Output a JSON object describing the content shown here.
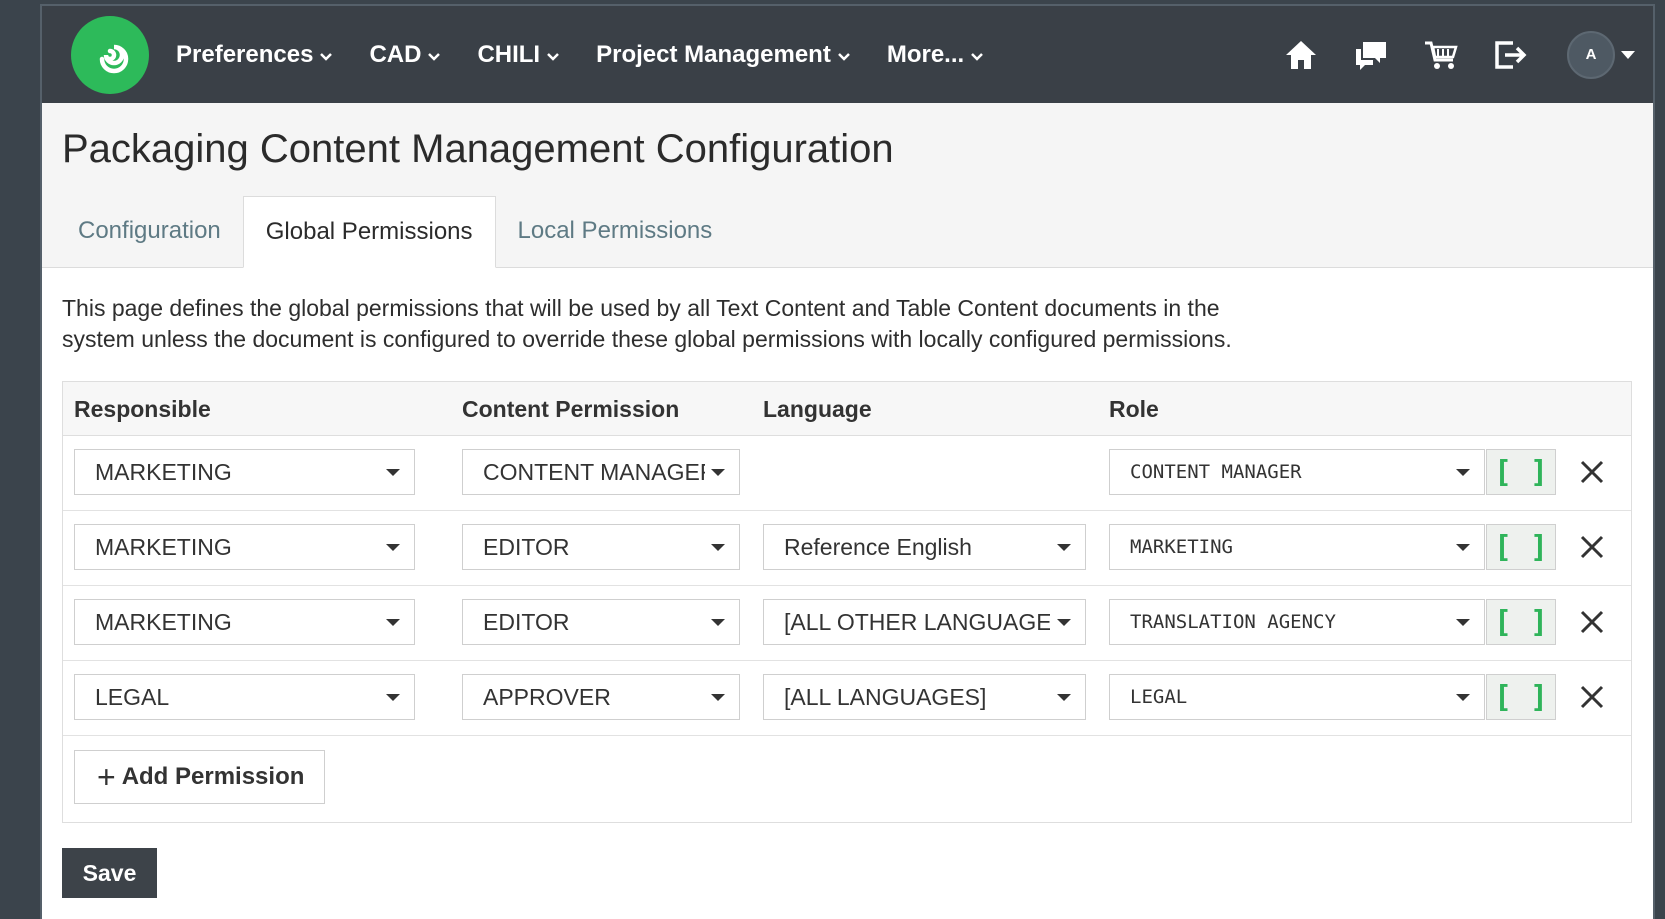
{
  "brand": {
    "logo_icon": "swirl-logo-icon",
    "accent": "#2dba5a"
  },
  "nav": {
    "items": [
      {
        "label": "Preferences"
      },
      {
        "label": "CAD"
      },
      {
        "label": "CHILI"
      },
      {
        "label": "Project Management"
      },
      {
        "label": "More..."
      }
    ],
    "right_icons": [
      "home-icon",
      "chat-icon",
      "cart-icon",
      "logout-icon"
    ],
    "avatar_initial": "A"
  },
  "page": {
    "title": "Packaging Content Management Configuration",
    "tabs": [
      {
        "label": "Configuration",
        "active": false
      },
      {
        "label": "Global Permissions",
        "active": true
      },
      {
        "label": "Local Permissions",
        "active": false
      }
    ],
    "description_line1": "This page defines the global permissions that will be used by all Text Content and Table Content documents in the",
    "description_line2": "system unless the document is configured to override these global permissions with locally configured permissions."
  },
  "table": {
    "headers": {
      "responsible": "Responsible",
      "content_permission": "Content Permission",
      "language": "Language",
      "role": "Role"
    },
    "rows": [
      {
        "responsible": "MARKETING",
        "content_permission": "CONTENT MANAGER",
        "language": "",
        "role": "CONTENT MANAGER"
      },
      {
        "responsible": "MARKETING",
        "content_permission": "EDITOR",
        "language": "Reference English",
        "role": "MARKETING"
      },
      {
        "responsible": "MARKETING",
        "content_permission": "EDITOR",
        "language": "[ALL OTHER LANGUAGES]",
        "role": "TRANSLATION AGENCY"
      },
      {
        "responsible": "LEGAL",
        "content_permission": "APPROVER",
        "language": "[ALL LANGUAGES]",
        "role": "LEGAL"
      }
    ],
    "bracket_label": "[ ]",
    "add_label": "Add Permission"
  },
  "actions": {
    "save_label": "Save"
  }
}
